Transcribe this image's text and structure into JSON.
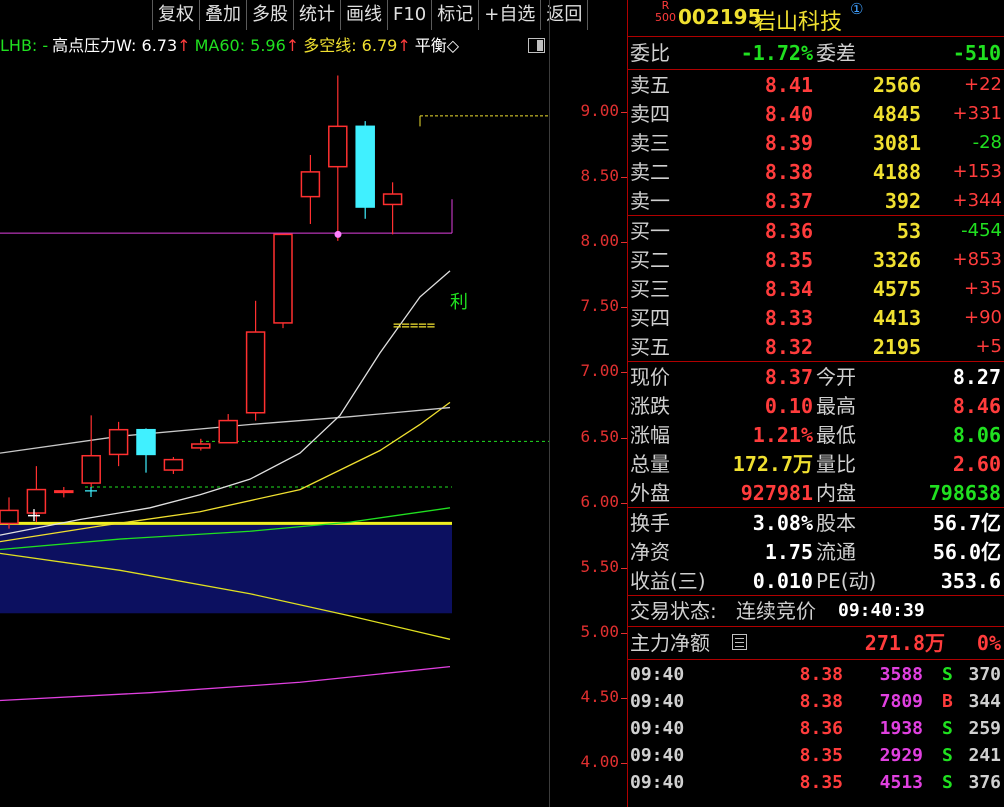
{
  "toolbar": [
    "复权",
    "叠加",
    "多股",
    "统计",
    "画线",
    "F10",
    "标记",
    "+自选",
    "返回"
  ],
  "indicators": {
    "lhb": "LHB: -",
    "resist": "高点压力W: 6.73",
    "ma60": "MA60: 5.96",
    "dk": "多空线: 6.79",
    "bal": "平衡◇",
    "colors": {
      "lhb": "#20e020",
      "resist": "#ffffff",
      "ma60": "#20e020",
      "dk": "#f0e030",
      "bal": "#ffffff",
      "arrow": "#ff3c3c"
    }
  },
  "chart": {
    "yticks": [
      "9.00",
      "8.50",
      "8.00",
      "7.50",
      "7.00",
      "6.50",
      "6.00",
      "5.50",
      "5.00",
      "4.50",
      "4.00"
    ],
    "ymin": 4.0,
    "ymax": 9.0,
    "annotation_text": "利",
    "annotation_marks": "=====",
    "candles": [
      {
        "o": 5.84,
        "c": 5.94,
        "h": 6.04,
        "l": 5.8
      },
      {
        "o": 5.92,
        "c": 6.1,
        "h": 6.28,
        "l": 5.85
      },
      {
        "o": 6.08,
        "c": 6.09,
        "h": 6.12,
        "l": 6.04
      },
      {
        "o": 6.15,
        "c": 6.36,
        "h": 6.67,
        "l": 6.12
      },
      {
        "o": 6.37,
        "c": 6.56,
        "h": 6.62,
        "l": 6.28
      },
      {
        "o": 6.56,
        "c": 6.37,
        "h": 6.57,
        "l": 6.23
      },
      {
        "o": 6.25,
        "c": 6.33,
        "h": 6.35,
        "l": 6.22
      },
      {
        "o": 6.42,
        "c": 6.45,
        "h": 6.49,
        "l": 6.4
      },
      {
        "o": 6.46,
        "c": 6.63,
        "h": 6.68,
        "l": 6.48
      },
      {
        "o": 6.69,
        "c": 7.31,
        "h": 7.55,
        "l": 6.63
      },
      {
        "o": 7.38,
        "c": 8.06,
        "h": 8.06,
        "l": 7.34
      },
      {
        "o": 8.35,
        "c": 8.54,
        "h": 8.67,
        "l": 8.14
      },
      {
        "o": 8.58,
        "c": 8.89,
        "h": 9.28,
        "l": 8.01
      },
      {
        "o": 8.89,
        "c": 8.27,
        "h": 8.93,
        "l": 8.18
      },
      {
        "o": 8.29,
        "c": 8.37,
        "h": 8.46,
        "l": 8.06
      }
    ]
  },
  "quote": {
    "r_label": "R",
    "r_num": "500",
    "code": "002195",
    "name": "岩山科技",
    "badge": "①",
    "weibi_label": "委比",
    "weibi": "-1.72%",
    "weicha_label": "委差",
    "weicha": "-510",
    "asks": [
      {
        "label": "卖五",
        "price": "8.41",
        "vol": "2566",
        "chg": "+22"
      },
      {
        "label": "卖四",
        "price": "8.40",
        "vol": "4845",
        "chg": "+331"
      },
      {
        "label": "卖三",
        "price": "8.39",
        "vol": "3081",
        "chg": "-28"
      },
      {
        "label": "卖二",
        "price": "8.38",
        "vol": "4188",
        "chg": "+153"
      },
      {
        "label": "卖一",
        "price": "8.37",
        "vol": "392",
        "chg": "+344"
      }
    ],
    "bids": [
      {
        "label": "买一",
        "price": "8.36",
        "vol": "53",
        "chg": "-454"
      },
      {
        "label": "买二",
        "price": "8.35",
        "vol": "3326",
        "chg": "+853"
      },
      {
        "label": "买三",
        "price": "8.34",
        "vol": "4575",
        "chg": "+35"
      },
      {
        "label": "买四",
        "price": "8.33",
        "vol": "4413",
        "chg": "+90"
      },
      {
        "label": "买五",
        "price": "8.32",
        "vol": "2195",
        "chg": "+5"
      }
    ],
    "stats": [
      {
        "l1": "现价",
        "v1": "8.37",
        "l2": "今开",
        "v2": "8.27"
      },
      {
        "l1": "涨跌",
        "v1": "0.10",
        "l2": "最高",
        "v2": "8.46"
      },
      {
        "l1": "涨幅",
        "v1": "1.21%",
        "l2": "最低",
        "v2": "8.06"
      },
      {
        "l1": "总量",
        "v1": "172.7万",
        "l2": "量比",
        "v2": "2.60"
      },
      {
        "l1": "外盘",
        "v1": "927981",
        "l2": "内盘",
        "v2": "798638"
      }
    ],
    "stats2": [
      {
        "l1": "换手",
        "v1": "3.08%",
        "l2": "股本",
        "v2": "56.7亿"
      },
      {
        "l1": "净资",
        "v1": "1.75",
        "l2": "流通",
        "v2": "56.0亿"
      },
      {
        "l1": "收益(三)",
        "v1": "0.010",
        "l2": "PE(动)",
        "v2": "353.6"
      }
    ],
    "status_label": "交易状态:",
    "status": "连续竞价",
    "status_time": "09:40:39",
    "main_label": "主力净额",
    "main_value": "271.8万",
    "main_pct": "0%",
    "ticks": [
      {
        "t": "09:40",
        "p": "8.38",
        "v": "3588",
        "s": "S",
        "n": "370"
      },
      {
        "t": "09:40",
        "p": "8.38",
        "v": "7809",
        "s": "B",
        "n": "344"
      },
      {
        "t": "09:40",
        "p": "8.36",
        "v": "1938",
        "s": "S",
        "n": "259"
      },
      {
        "t": "09:40",
        "p": "8.35",
        "v": "2929",
        "s": "S",
        "n": "241"
      },
      {
        "t": "09:40",
        "p": "8.35",
        "v": "4513",
        "s": "S",
        "n": "376"
      }
    ]
  }
}
